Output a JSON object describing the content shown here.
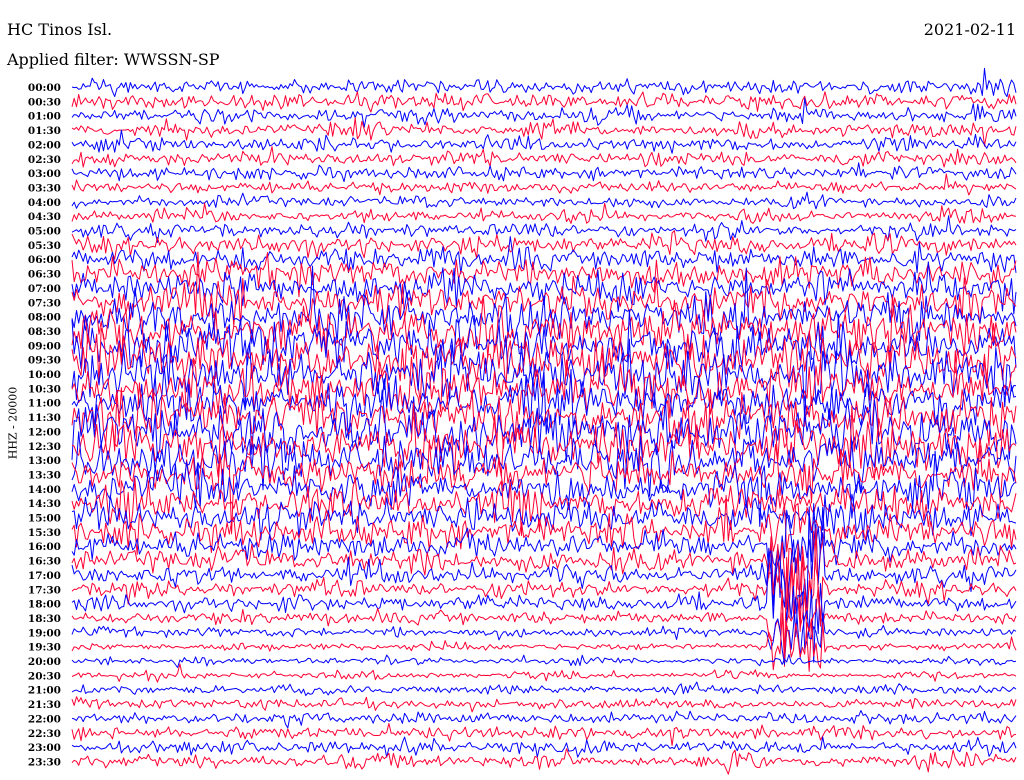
{
  "header": {
    "station": "HC Tinos Isl.",
    "date": "2021-02-11",
    "filter": "Applied filter: WWSSN-SP"
  },
  "chart_data": {
    "type": "line",
    "title": "HC Tinos Isl.",
    "date": "2021-02-11",
    "filter": "WWSSN-SP",
    "ylabel": "HHZ - 20000",
    "trace_colors": [
      "#0000ff",
      "#ff0033"
    ],
    "rows": [
      {
        "time": "00:00",
        "amp": 0.55
      },
      {
        "time": "00:30",
        "amp": 0.6
      },
      {
        "time": "01:00",
        "amp": 0.6
      },
      {
        "time": "01:30",
        "amp": 0.6
      },
      {
        "time": "02:00",
        "amp": 0.55
      },
      {
        "time": "02:30",
        "amp": 0.55
      },
      {
        "time": "03:00",
        "amp": 0.5
      },
      {
        "time": "03:30",
        "amp": 0.45
      },
      {
        "time": "04:00",
        "amp": 0.45
      },
      {
        "time": "04:30",
        "amp": 0.5
      },
      {
        "time": "05:00",
        "amp": 0.6
      },
      {
        "time": "05:30",
        "amp": 0.75
      },
      {
        "time": "06:00",
        "amp": 0.9
      },
      {
        "time": "06:30",
        "amp": 1.1
      },
      {
        "time": "07:00",
        "amp": 1.3
      },
      {
        "time": "07:30",
        "amp": 1.5
      },
      {
        "time": "08:00",
        "amp": 1.7
      },
      {
        "time": "08:30",
        "amp": 1.8
      },
      {
        "time": "09:00",
        "amp": 1.9
      },
      {
        "time": "09:30",
        "amp": 2.0
      },
      {
        "time": "10:00",
        "amp": 2.0
      },
      {
        "time": "10:30",
        "amp": 2.0
      },
      {
        "time": "11:00",
        "amp": 2.0
      },
      {
        "time": "11:30",
        "amp": 1.9
      },
      {
        "time": "12:00",
        "amp": 1.9
      },
      {
        "time": "12:30",
        "amp": 1.8
      },
      {
        "time": "13:00",
        "amp": 1.7
      },
      {
        "time": "13:30",
        "amp": 1.6
      },
      {
        "time": "14:00",
        "amp": 1.5
      },
      {
        "time": "14:30",
        "amp": 1.4
      },
      {
        "time": "15:00",
        "amp": 1.3
      },
      {
        "time": "15:30",
        "amp": 1.2
      },
      {
        "time": "16:00",
        "amp": 1.0
      },
      {
        "time": "16:30",
        "amp": 0.9
      },
      {
        "time": "17:00",
        "amp": 0.8
      },
      {
        "time": "17:30",
        "amp": 0.7
      },
      {
        "time": "18:00",
        "amp": 0.6
      },
      {
        "time": "18:30",
        "amp": 0.5
      },
      {
        "time": "19:00",
        "amp": 0.35
      },
      {
        "time": "19:30",
        "amp": 0.3
      },
      {
        "time": "20:00",
        "amp": 0.3
      },
      {
        "time": "20:30",
        "amp": 0.3
      },
      {
        "time": "21:00",
        "amp": 0.35
      },
      {
        "time": "21:30",
        "amp": 0.4
      },
      {
        "time": "22:00",
        "amp": 0.45
      },
      {
        "time": "22:30",
        "amp": 0.5
      },
      {
        "time": "23:00",
        "amp": 0.55
      },
      {
        "time": "23:30",
        "amp": 0.6
      }
    ],
    "events": [
      {
        "start_time": "15:30",
        "end_time": "19:30",
        "minute": 23
      }
    ]
  }
}
